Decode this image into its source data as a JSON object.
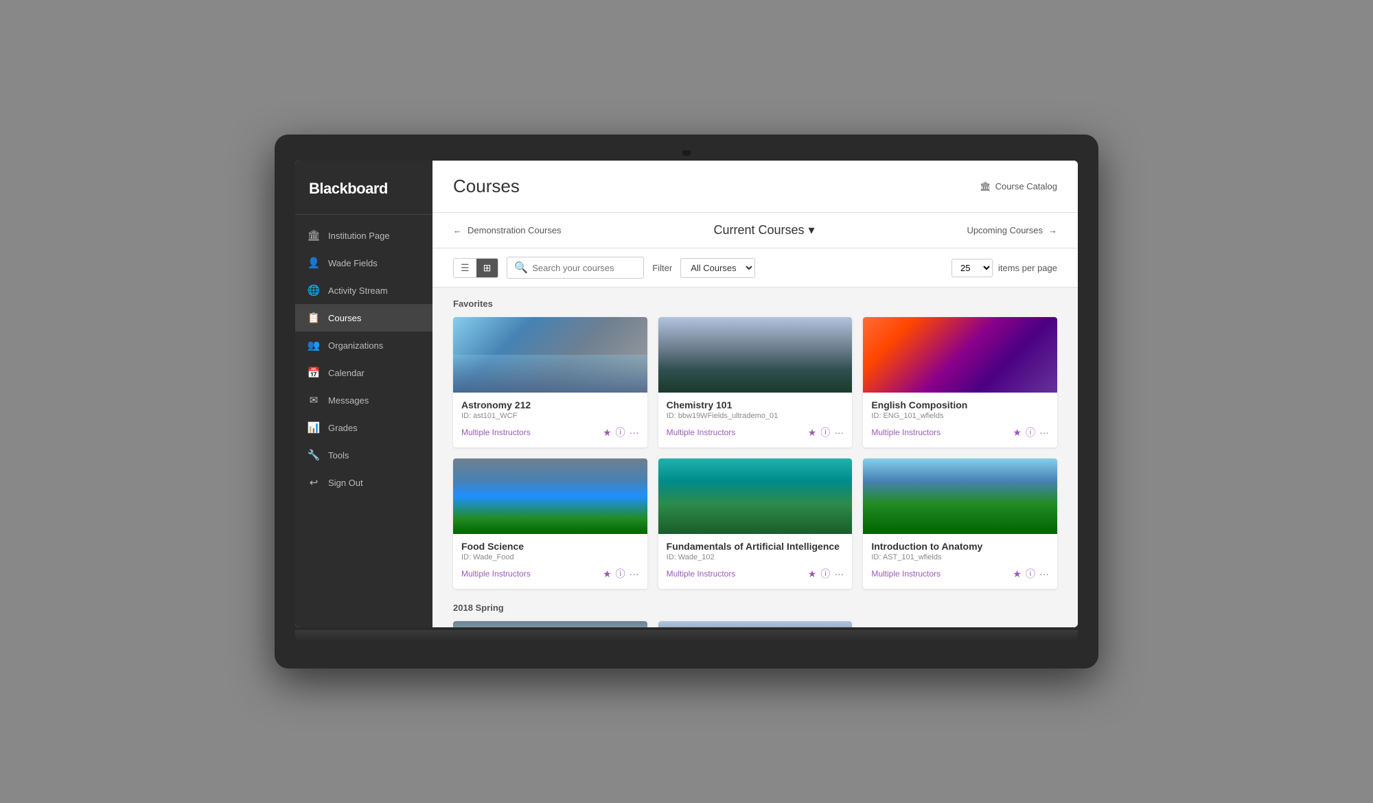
{
  "app": {
    "name": "Blackboard"
  },
  "header": {
    "title": "Courses",
    "course_catalog": "Course Catalog"
  },
  "nav": {
    "prev": "Demonstration Courses",
    "current": "Current Courses",
    "next": "Upcoming Courses"
  },
  "toolbar": {
    "search_placeholder": "Search your courses",
    "filter_label": "Filter",
    "filter_default": "All Courses",
    "items_per_page_value": "25",
    "items_per_page_label": "items per page"
  },
  "sidebar": {
    "items": [
      {
        "id": "institution",
        "label": "Institution Page",
        "icon": "🏛"
      },
      {
        "id": "profile",
        "label": "Wade Fields",
        "icon": "👤"
      },
      {
        "id": "activity",
        "label": "Activity Stream",
        "icon": "🌐"
      },
      {
        "id": "courses",
        "label": "Courses",
        "icon": "📋",
        "active": true
      },
      {
        "id": "organizations",
        "label": "Organizations",
        "icon": "👥"
      },
      {
        "id": "calendar",
        "label": "Calendar",
        "icon": "📅"
      },
      {
        "id": "messages",
        "label": "Messages",
        "icon": "✉"
      },
      {
        "id": "grades",
        "label": "Grades",
        "icon": "📊"
      },
      {
        "id": "tools",
        "label": "Tools",
        "icon": "🔧"
      },
      {
        "id": "signout",
        "label": "Sign Out",
        "icon": "↩"
      }
    ]
  },
  "sections": [
    {
      "label": "Favorites",
      "courses": [
        {
          "name": "Astronomy 212",
          "id": "ID: ast101_WCF",
          "instructors": "Multiple Instructors",
          "img_class": "img-astronomy"
        },
        {
          "name": "Chemistry 101",
          "id": "ID: bbw19WFields_ultrademo_01",
          "instructors": "Multiple Instructors",
          "img_class": "img-chemistry"
        },
        {
          "name": "English Composition",
          "id": "ID: ENG_101_wfields",
          "instructors": "Multiple Instructors",
          "img_class": "img-english"
        },
        {
          "name": "Food Science",
          "id": "ID: Wade_Food",
          "instructors": "Multiple Instructors",
          "img_class": "img-food"
        },
        {
          "name": "Fundamentals of Artificial Intelligence",
          "id": "ID: Wade_102",
          "instructors": "Multiple Instructors",
          "img_class": "img-ai"
        },
        {
          "name": "Introduction to Anatomy",
          "id": "ID: AST_101_wfields",
          "instructors": "Multiple Instructors",
          "img_class": "img-anatomy"
        }
      ]
    },
    {
      "label": "2018 Spring",
      "courses": [
        {
          "name": "",
          "id": "",
          "instructors": "",
          "img_class": "img-spring1"
        },
        {
          "name": "",
          "id": "",
          "instructors": "",
          "img_class": "img-spring2"
        }
      ]
    }
  ]
}
